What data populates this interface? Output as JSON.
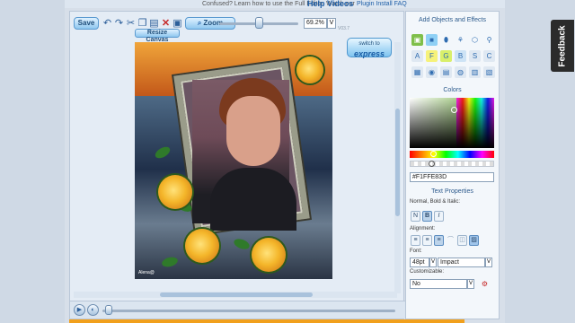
{
  "help": {
    "lead": "Confused? Learn how to use the Full Editor. Watch our",
    "link": "Help Videos",
    "right": "Plugin Install FAQ"
  },
  "feedback": "Feedback",
  "toolbar": {
    "save_label": "Save",
    "zoom_label": "Zoom",
    "zoom_value": "69.2%",
    "zoom_dropdown": "V",
    "zoom_level": 0.5,
    "version": "V03.7",
    "resize_label": "Resize Canvas",
    "switch_line1": "switch to",
    "switch_line2": "express"
  },
  "canvas": {
    "watermark": "Alena@"
  },
  "timeline": {
    "position": 0.02
  },
  "panel": {
    "add_title": "Add Objects and Effects",
    "colors_title": "Colors",
    "hex_value": "#F1FFE83D",
    "text_props_title": "Text Properties",
    "style_label": "Normal, Bold & Italic:",
    "n_label": "N",
    "b_label": "B",
    "i_label": "I",
    "alignment_label": "Alignment:",
    "font_label": "Font:",
    "font_size": "48pt",
    "font_size_drop": "V",
    "font_name": "Impact",
    "font_name_drop": "V",
    "customizable_label": "Customizable:",
    "customizable_value": "No",
    "customizable_drop": "V"
  },
  "colors": {
    "accent": "#f1a01d",
    "button": "#8fc7ef",
    "title": "#2c5a8c"
  }
}
